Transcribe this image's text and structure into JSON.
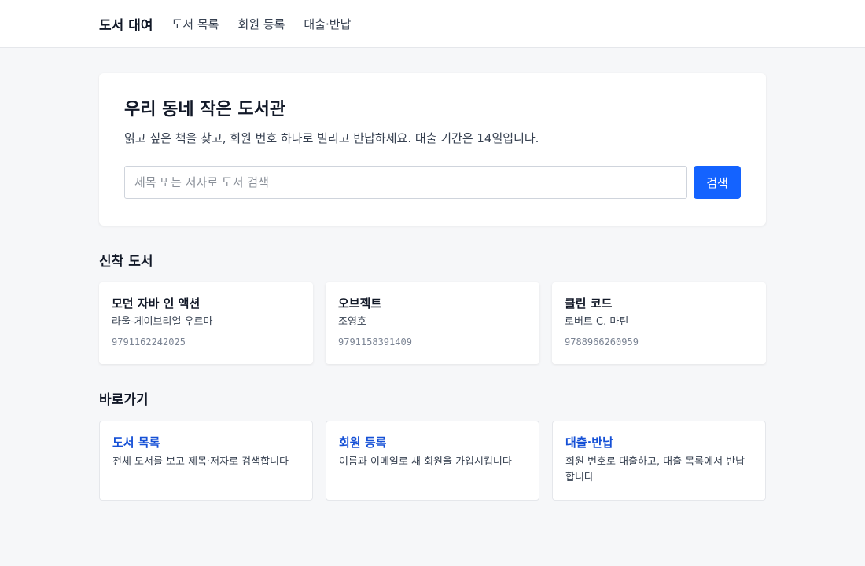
{
  "nav": {
    "brand": "도서 대여",
    "links": [
      "도서 목록",
      "회원 등록",
      "대출·반납"
    ]
  },
  "hero": {
    "title": "우리 동네 작은 도서관",
    "lead": "읽고 싶은 책을 찾고, 회원 번호 하나로 빌리고 반납하세요. 대출 기간은 14일입니다.",
    "search_placeholder": "제목 또는 저자로 도서 검색",
    "search_value": "",
    "search_button": "검색"
  },
  "new_books": {
    "title": "신착 도서",
    "items": [
      {
        "title": "모던 자바 인 액션",
        "author": "라울-게이브리얼 우르마",
        "isbn": "9791162242025"
      },
      {
        "title": "오브젝트",
        "author": "조영호",
        "isbn": "9791158391409"
      },
      {
        "title": "클린 코드",
        "author": "로버트 C. 마틴",
        "isbn": "9788966260959"
      }
    ]
  },
  "shortcuts": {
    "title": "바로가기",
    "items": [
      {
        "title": "도서 목록",
        "desc": "전체 도서를 보고 제목·저자로 검색합니다"
      },
      {
        "title": "회원 등록",
        "desc": "이름과 이메일로 새 회원을 가입시킵니다"
      },
      {
        "title": "대출·반납",
        "desc": "회원 번호로 대출하고, 대출 목록에서 반납합니다"
      }
    ]
  },
  "colors": {
    "accent": "#1463ff",
    "link": "#1550d6",
    "background": "#f6f7f9"
  }
}
